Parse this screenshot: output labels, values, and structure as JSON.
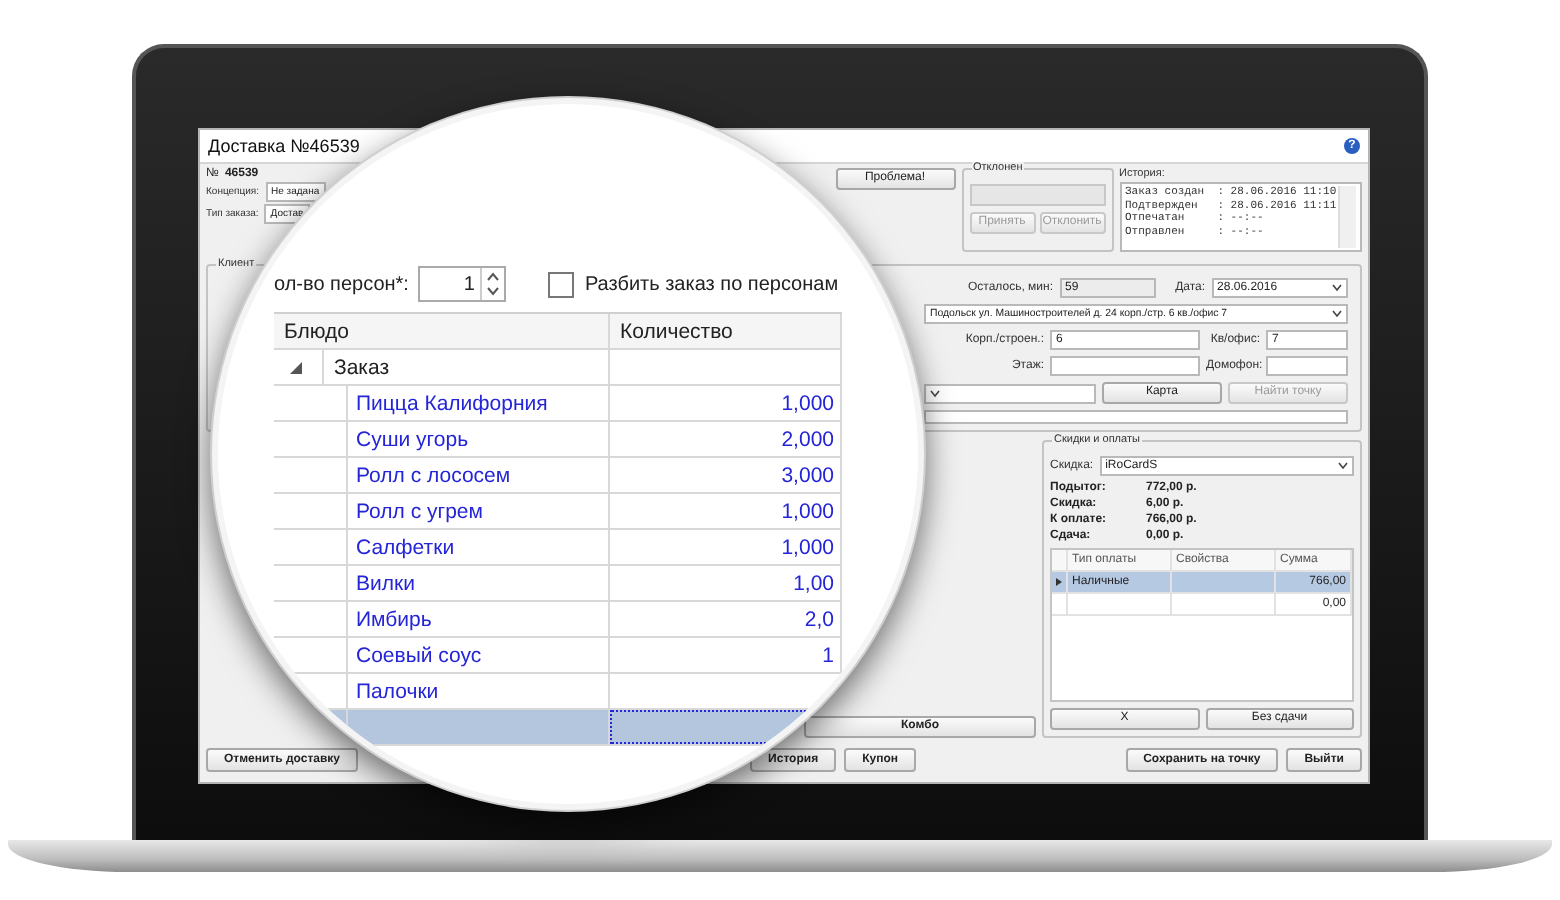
{
  "window": {
    "title": "Доставка №46539",
    "help": "?"
  },
  "header": {
    "number_label": "№",
    "number": "46539",
    "fields": [
      {
        "label": "Концепция:",
        "value": "Не задана"
      },
      {
        "label": "Тип заказа:",
        "value": "Достав"
      }
    ]
  },
  "problem_button": "Проблема!",
  "rejected": {
    "title": "Отклонен",
    "buttons": [
      {
        "label": "Принять",
        "disabled": true
      },
      {
        "label": "Отклонить",
        "disabled": true
      }
    ]
  },
  "history": {
    "title": "История:",
    "lines": [
      "Заказ создан  : 28.06.2016 11:10",
      "Подтвержден   : 28.06.2016 11:11",
      "Отпечатан     : --:--",
      "Отправлен     : --:--"
    ]
  },
  "client": {
    "title": "Клиент",
    "remaining_label": "Осталось, мин:",
    "remaining": "59",
    "date_label": "Дата:",
    "date": "28.06.2016",
    "address": "Подольск ул. Машиностроителей д. 24 корп./стр. 6 кв./офис 7",
    "fields": [
      {
        "label": "Корп./строен.:",
        "value": "6"
      },
      {
        "label": "Кв/офис:",
        "value": "7"
      },
      {
        "label": "Этаж:"
      },
      {
        "label": "Домофон:"
      }
    ],
    "buttons": [
      {
        "label": "Карта",
        "disabled": false
      },
      {
        "label": "Найти точку",
        "disabled": true
      }
    ]
  },
  "combo_button": "Комбо",
  "payments": {
    "title": "Скидки и оплаты",
    "discount_label": "Скидка:",
    "discount": "iRoCardS",
    "summary": [
      {
        "label": "Подытог:",
        "value": "772,00 р."
      },
      {
        "label": "Скидка:",
        "value": "6,00 р."
      },
      {
        "label": "К оплате:",
        "value": "766,00 р."
      },
      {
        "label": "Сдача:",
        "value": "0,00 р."
      }
    ],
    "columns": [
      "Тип оплаты",
      "Свойства",
      "Сумма"
    ],
    "rows": [
      {
        "type": "Наличные",
        "amount": "766,00",
        "selected": true
      },
      {
        "amount": "0,00",
        "selected": false
      }
    ],
    "buttons": [
      "X",
      "Без сдачи"
    ]
  },
  "footer": {
    "start": [
      "Отменить доставку"
    ],
    "middle": [
      "История",
      "Купон"
    ],
    "end": [
      "Сохранить на точку",
      "Выйти"
    ]
  },
  "lens": {
    "persons_label": "ол-во персон*:",
    "persons": "1",
    "split": {
      "label": "Разбить заказ по персонам",
      "checked": false
    },
    "columns": [
      "Блюдо",
      "Количество"
    ],
    "group": {
      "name": "Заказ",
      "expanded": true,
      "children": [
        {
          "name": "Пицца Калифорния",
          "quantity": "1,000",
          "selected": false
        },
        {
          "name": "Суши угорь",
          "quantity": "2,000",
          "selected": false
        },
        {
          "name": "Ролл с лососем",
          "quantity": "3,000",
          "selected": false
        },
        {
          "name": "Ролл с угрем",
          "quantity": "1,000",
          "selected": false
        },
        {
          "name": "Салфетки",
          "quantity": "1,000",
          "selected": false
        },
        {
          "name": "Вилки",
          "quantity": "1,00",
          "selected": false
        },
        {
          "name": "Имбирь",
          "quantity": "2,0",
          "selected": false
        },
        {
          "name": "Соевый соус",
          "quantity": "1",
          "selected": false
        },
        {
          "name": "Палочки",
          "selected": false
        },
        {
          "selected": true
        }
      ]
    }
  }
}
